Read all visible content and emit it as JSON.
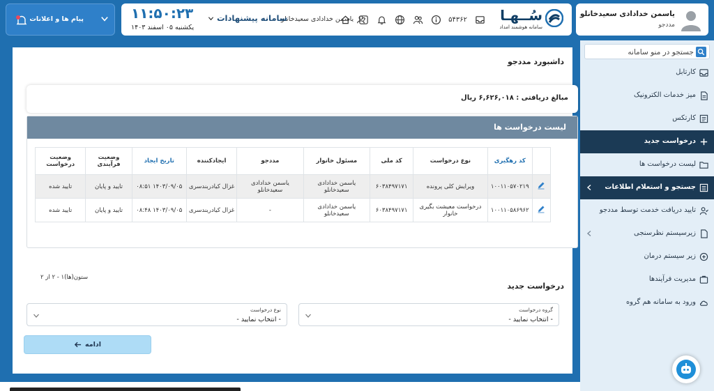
{
  "profile": {
    "name": "یاسمن خدادادی سعیدخانلو",
    "role": "مددجو"
  },
  "logo": {
    "title": "سُــهـا",
    "subtitle": "سامانه هوشمند امداد",
    "icon": "soha-logo-icon"
  },
  "header": {
    "code": "۵۴۳۶۲",
    "user_name": "یاسمن خدادادی سعیدخانلو",
    "system_name": "سامانه پیشنهادات",
    "clock": "۱۱:۵۰:۲۳",
    "date": "یکشنبه ۰۵ اسفند ۱۴۰۳",
    "icons": [
      "inbox-icon",
      "info-icon",
      "users-icon",
      "globe-icon",
      "bell-icon",
      "help-icon",
      "home-icon",
      "user-icon"
    ]
  },
  "notifications": {
    "label": "پیام ها و اعلانات"
  },
  "sidebar": {
    "search_placeholder": "جستجو در منو سامانه",
    "items": [
      {
        "label": "کارتابل",
        "icon": "inbox-icon"
      },
      {
        "label": "میز خدمات الکترونیک",
        "icon": "document-icon"
      },
      {
        "label": "کارتکس",
        "icon": "cardex-icon"
      },
      {
        "label": "درخواست جدید",
        "icon": "plus-icon"
      },
      {
        "label": "لیست درخواست ها",
        "icon": "folder-icon"
      },
      {
        "label": "جستجو و استعلام اطلاعات",
        "icon": "list-icon"
      },
      {
        "label": "تایید دریافت خدمت توسط مددجو",
        "icon": "user-check-icon"
      },
      {
        "label": "زیرسیستم نظرسنجی",
        "icon": "file-icon"
      },
      {
        "label": "زیر سیستم درمان",
        "icon": "health-icon"
      },
      {
        "label": "مدیریت فرآیندها",
        "icon": "process-icon"
      },
      {
        "label": "ورود به سامانه هم گروه",
        "icon": "cloud-icon"
      }
    ]
  },
  "main": {
    "title": "داشبورد مددجو",
    "amount_text": "مبالغ دریافتی : ۶,۶۲۶,۰۱۸ ریال",
    "list_title": "لیست درخواست ها",
    "table": {
      "headers": [
        "کد رهگیری",
        "نوع درخواست",
        "کد ملی",
        "مسئول خانوار",
        "مددجو",
        "ایجادکننده",
        "تاریخ ایجاد",
        "وضعیت فرآیندی",
        "وضعیت درخواست"
      ],
      "rows": [
        [
          "۱۰۰۱۱۰۵۷۰۲۱۹",
          "ویرایش کلی پرونده",
          "۶۰۳۸۴۹۷۱۷۱",
          "یاسمن خدادادی سعیدخانلو",
          "یاسمن خدادادی سعیدخانلو",
          "غزال کیادربندسری",
          "۱۴۰۳/۰۹/۰۵ ۰۸:۵۱",
          "تایید و پایان",
          "تایید شده"
        ],
        [
          "۱۰۰۱۱۰۵۸۶۹۶۲",
          "درخواست معیشت بگیری خانوار",
          "۶۰۳۸۴۹۷۱۷۱",
          "یاسمن خدادادی سعیدخانلو",
          "-",
          "غزال کیادربندسری",
          "۱۴۰۳/۰۹/۰۵ ۰۸:۴۸",
          "تایید و پایان",
          "تایید شده"
        ]
      ]
    },
    "pager_text": "ستون(ها)۱ - ۲ از ۲",
    "new_request_title": "درخواست جدید",
    "group_label": "گروه درخواست",
    "group_value": "- انتخاب نمایید -",
    "type_label": "نوع درخواست",
    "type_value": "- انتخاب نمایید -",
    "continue_label": "ادامه"
  },
  "colors": {
    "brand": "#1f6fb0",
    "sidebar_active": "#1b3a55",
    "table_header": "#6f89a0",
    "button": "#aedcf6"
  }
}
